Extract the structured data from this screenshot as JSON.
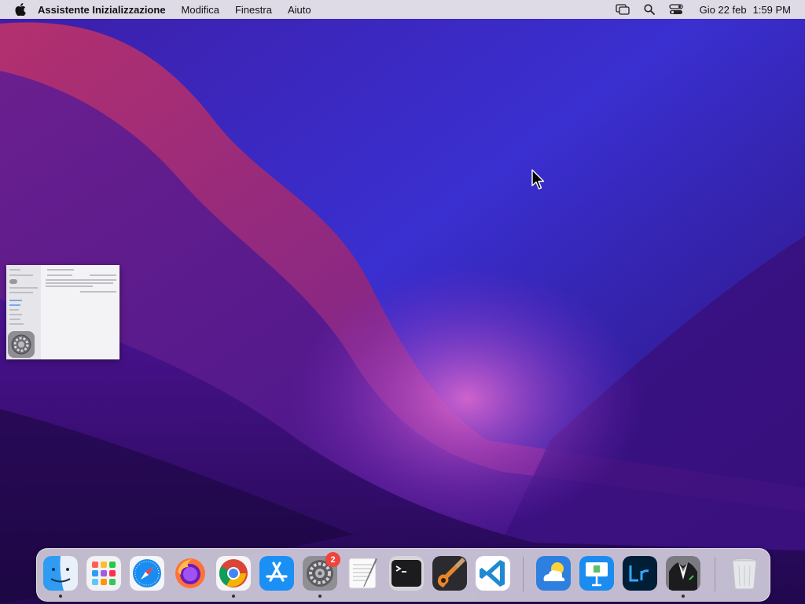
{
  "menubar": {
    "app_name": "Assistente Inizializzazione",
    "menus": [
      "Modifica",
      "Finestra",
      "Aiuto"
    ],
    "date": "Gio 22 feb",
    "time": "1:59 PM"
  },
  "dock": {
    "system_preferences_badge": "2"
  },
  "colors": {
    "menubar_bg": "#dedbe6",
    "badge_red": "#f0443a"
  }
}
